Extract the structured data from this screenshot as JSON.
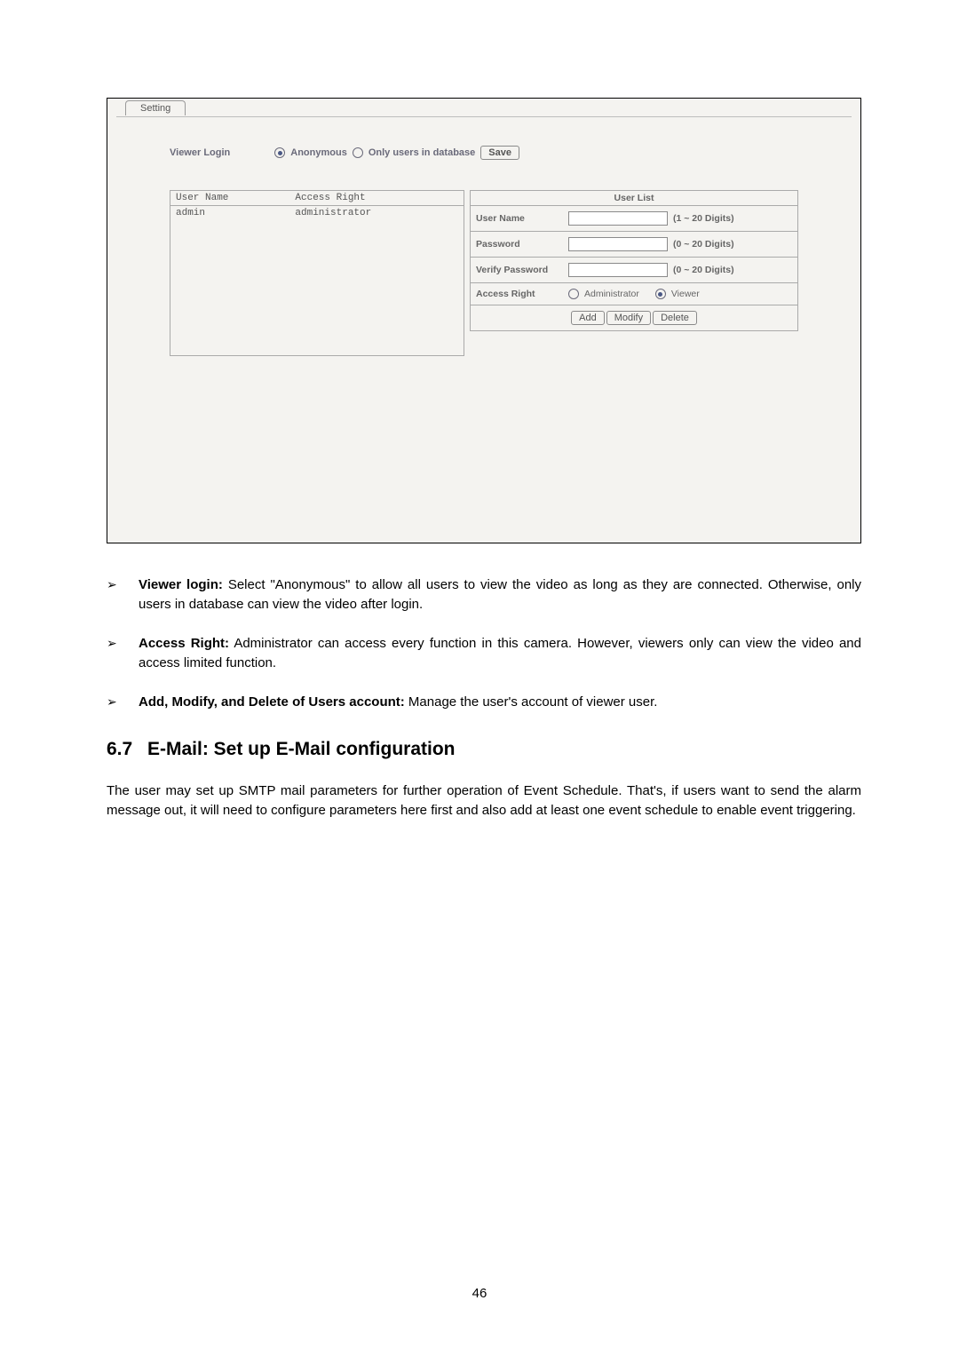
{
  "ui": {
    "tab_label": "Setting",
    "viewer_login_label": "Viewer Login",
    "opt_anon": "Anonymous",
    "opt_db": "Only users in database",
    "save_btn": "Save",
    "left_hdr_user": "User Name",
    "left_hdr_access": "Access Right",
    "left_row_user": "admin",
    "left_row_access": "administrator",
    "userlist_title": "User List",
    "f_user": "User Name",
    "f_pass": "Password",
    "f_vpass": "Verify Password",
    "f_access": "Access Right",
    "hint_1_20": "(1 ~ 20 Digits)",
    "hint_0_20": "(0 ~ 20 Digits)",
    "opt_admin": "Administrator",
    "opt_viewer": "Viewer",
    "btn_add": "Add",
    "btn_modify": "Modify",
    "btn_delete": "Delete"
  },
  "bullets": {
    "b1_bold": "Viewer login:",
    "b1_text": " Select \"Anonymous\" to allow all users to view the video as long as they are connected. Otherwise, only users in database can view the video after login.",
    "b2_bold": "Access Right:",
    "b2_text": " Administrator can access every function in this camera. However, viewers only can view the video and access limited function.",
    "b3_bold": "Add, Modify, and Delete of Users account:",
    "b3_text": " Manage the user's account of viewer user."
  },
  "section": {
    "num": "6.7",
    "title": "E-Mail: Set up E-Mail configuration"
  },
  "para": "The user may set up SMTP mail parameters for further operation of Event Schedule. That's, if users want to send the alarm message out, it will need to configure parameters here first and also add at least one event schedule to enable event triggering.",
  "page_number": "46"
}
